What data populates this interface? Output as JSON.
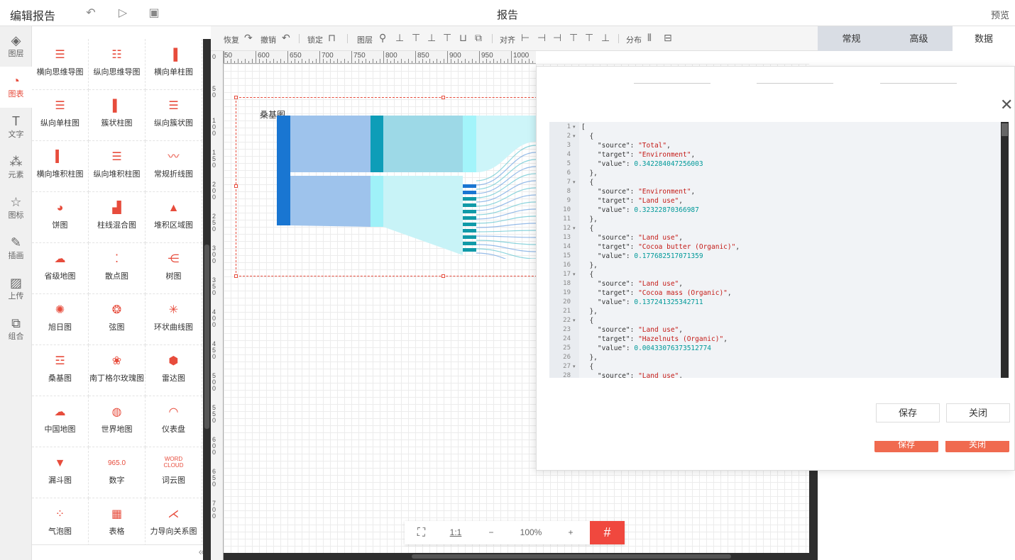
{
  "header": {
    "title": "编辑报告",
    "center_title": "报告",
    "preview": "预览",
    "undo_icon": "undo-icon",
    "play_icon": "play-icon",
    "save_icon": "save-icon"
  },
  "left_nav": [
    {
      "label": "图层",
      "icon": "layers-icon"
    },
    {
      "label": "图表",
      "icon": "chart-pie-icon",
      "active": true
    },
    {
      "label": "文字",
      "icon": "text-icon"
    },
    {
      "label": "元素",
      "icon": "elements-icon"
    },
    {
      "label": "图标",
      "icon": "star-icon"
    },
    {
      "label": "插画",
      "icon": "palette-icon"
    },
    {
      "label": "上传",
      "icon": "image-upload-icon"
    },
    {
      "label": "组合",
      "icon": "group-icon"
    }
  ],
  "palette": [
    {
      "label": "横向思维导图",
      "icon": "mindmap-h-icon"
    },
    {
      "label": "纵向思维导图",
      "icon": "mindmap-v-icon"
    },
    {
      "label": "横向单柱图",
      "icon": "bar-h-icon"
    },
    {
      "label": "纵向单柱图",
      "icon": "bar-v-icon"
    },
    {
      "label": "簇状柱图",
      "icon": "cluster-bar-icon"
    },
    {
      "label": "纵向簇状图",
      "icon": "cluster-v-icon"
    },
    {
      "label": "横向堆积柱图",
      "icon": "stack-h-icon"
    },
    {
      "label": "纵向堆积柱图",
      "icon": "stack-v-icon"
    },
    {
      "label": "常规折线图",
      "icon": "line-icon"
    },
    {
      "label": "饼图",
      "icon": "pie-icon"
    },
    {
      "label": "柱线混合图",
      "icon": "bar-line-icon"
    },
    {
      "label": "堆积区域图",
      "icon": "area-icon"
    },
    {
      "label": "省级地图",
      "icon": "province-map-icon"
    },
    {
      "label": "散点图",
      "icon": "scatter-icon"
    },
    {
      "label": "树图",
      "icon": "tree-icon"
    },
    {
      "label": "旭日图",
      "icon": "sunburst-icon"
    },
    {
      "label": "弦图",
      "icon": "chord-icon"
    },
    {
      "label": "环状曲线图",
      "icon": "ring-curve-icon"
    },
    {
      "label": "桑基图",
      "icon": "sankey-icon"
    },
    {
      "label": "南丁格尔玫瑰图",
      "icon": "rose-icon"
    },
    {
      "label": "雷达图",
      "icon": "radar-icon"
    },
    {
      "label": "中国地图",
      "icon": "china-map-icon"
    },
    {
      "label": "世界地图",
      "icon": "world-map-icon"
    },
    {
      "label": "仪表盘",
      "icon": "gauge-icon"
    },
    {
      "label": "漏斗图",
      "icon": "funnel-icon"
    },
    {
      "label": "数字",
      "icon": "number-icon"
    },
    {
      "label": "词云图",
      "icon": "wordcloud-icon"
    },
    {
      "label": "气泡图",
      "icon": "bubble-icon"
    },
    {
      "label": "表格",
      "icon": "table-icon"
    },
    {
      "label": "力导向关系图",
      "icon": "force-graph-icon"
    }
  ],
  "palette_icon_text": {
    "number": "965.0",
    "word": "WORD",
    "cloud": "CLOUD"
  },
  "toolbar": {
    "restore": "恢复",
    "undo": "撤销",
    "lock": "锁定",
    "layer": "图层",
    "align": "对齐",
    "distribute": "分布"
  },
  "right_tabs": [
    "常规",
    "高级",
    "数据"
  ],
  "ruler_h": [
    "50",
    "600",
    "650",
    "700",
    "750",
    "800",
    "850",
    "900",
    "950",
    "1000"
  ],
  "ruler_v": [
    "0",
    "50",
    "100",
    "150",
    "200",
    "250",
    "300",
    "350",
    "400",
    "450",
    "500",
    "550",
    "600",
    "650",
    "700"
  ],
  "chart": {
    "title": "桑基图"
  },
  "zoom": {
    "fit_icon": "fit-screen-icon",
    "ratio": "1:1",
    "minus": "−",
    "value": "100%",
    "plus": "+",
    "grid_icon": "grid-icon"
  },
  "dialog": {
    "close_icon": "close-icon",
    "save": "保存",
    "close": "关闭",
    "save_behind": "保存",
    "close_behind": "关闭",
    "code_lines": [
      {
        "n": "1",
        "fold": true,
        "text": "["
      },
      {
        "n": "2",
        "fold": true,
        "text": "  {"
      },
      {
        "n": "3",
        "k": "    \"source\": ",
        "s": "\"Total\"",
        "tail": ","
      },
      {
        "n": "4",
        "k": "    \"target\": ",
        "s": "\"Environment\"",
        "tail": ","
      },
      {
        "n": "5",
        "k": "    \"value\": ",
        "v": "0.342284047256003"
      },
      {
        "n": "6",
        "text": "  },"
      },
      {
        "n": "7",
        "fold": true,
        "text": "  {"
      },
      {
        "n": "8",
        "k": "    \"source\": ",
        "s": "\"Environment\"",
        "tail": ","
      },
      {
        "n": "9",
        "k": "    \"target\": ",
        "s": "\"Land use\"",
        "tail": ","
      },
      {
        "n": "10",
        "k": "    \"value\": ",
        "v": "0.32322870366987"
      },
      {
        "n": "11",
        "text": "  },"
      },
      {
        "n": "12",
        "fold": true,
        "text": "  {"
      },
      {
        "n": "13",
        "k": "    \"source\": ",
        "s": "\"Land use\"",
        "tail": ","
      },
      {
        "n": "14",
        "k": "    \"target\": ",
        "s": "\"Cocoa butter (Organic)\"",
        "tail": ","
      },
      {
        "n": "15",
        "k": "    \"value\": ",
        "v": "0.177682517071359"
      },
      {
        "n": "16",
        "text": "  },"
      },
      {
        "n": "17",
        "fold": true,
        "text": "  {"
      },
      {
        "n": "18",
        "k": "    \"source\": ",
        "s": "\"Land use\"",
        "tail": ","
      },
      {
        "n": "19",
        "k": "    \"target\": ",
        "s": "\"Cocoa mass (Organic)\"",
        "tail": ","
      },
      {
        "n": "20",
        "k": "    \"value\": ",
        "v": "0.137241325342711"
      },
      {
        "n": "21",
        "text": "  },"
      },
      {
        "n": "22",
        "fold": true,
        "text": "  {"
      },
      {
        "n": "23",
        "k": "    \"source\": ",
        "s": "\"Land use\"",
        "tail": ","
      },
      {
        "n": "24",
        "k": "    \"target\": ",
        "s": "\"Hazelnuts (Organic)\"",
        "tail": ","
      },
      {
        "n": "25",
        "k": "    \"value\": ",
        "v": "0.00433076373512774"
      },
      {
        "n": "26",
        "text": "  },"
      },
      {
        "n": "27",
        "fold": true,
        "text": "  {"
      },
      {
        "n": "28",
        "k": "    \"source\": ",
        "s": "\"Land use\"",
        "tail": ","
      }
    ]
  },
  "colors": {
    "accent": "#e74c3c",
    "grid_btn": "#f0483e",
    "tab_gray": "#d9dde4",
    "string": "#c41a16",
    "number": "#009999"
  }
}
